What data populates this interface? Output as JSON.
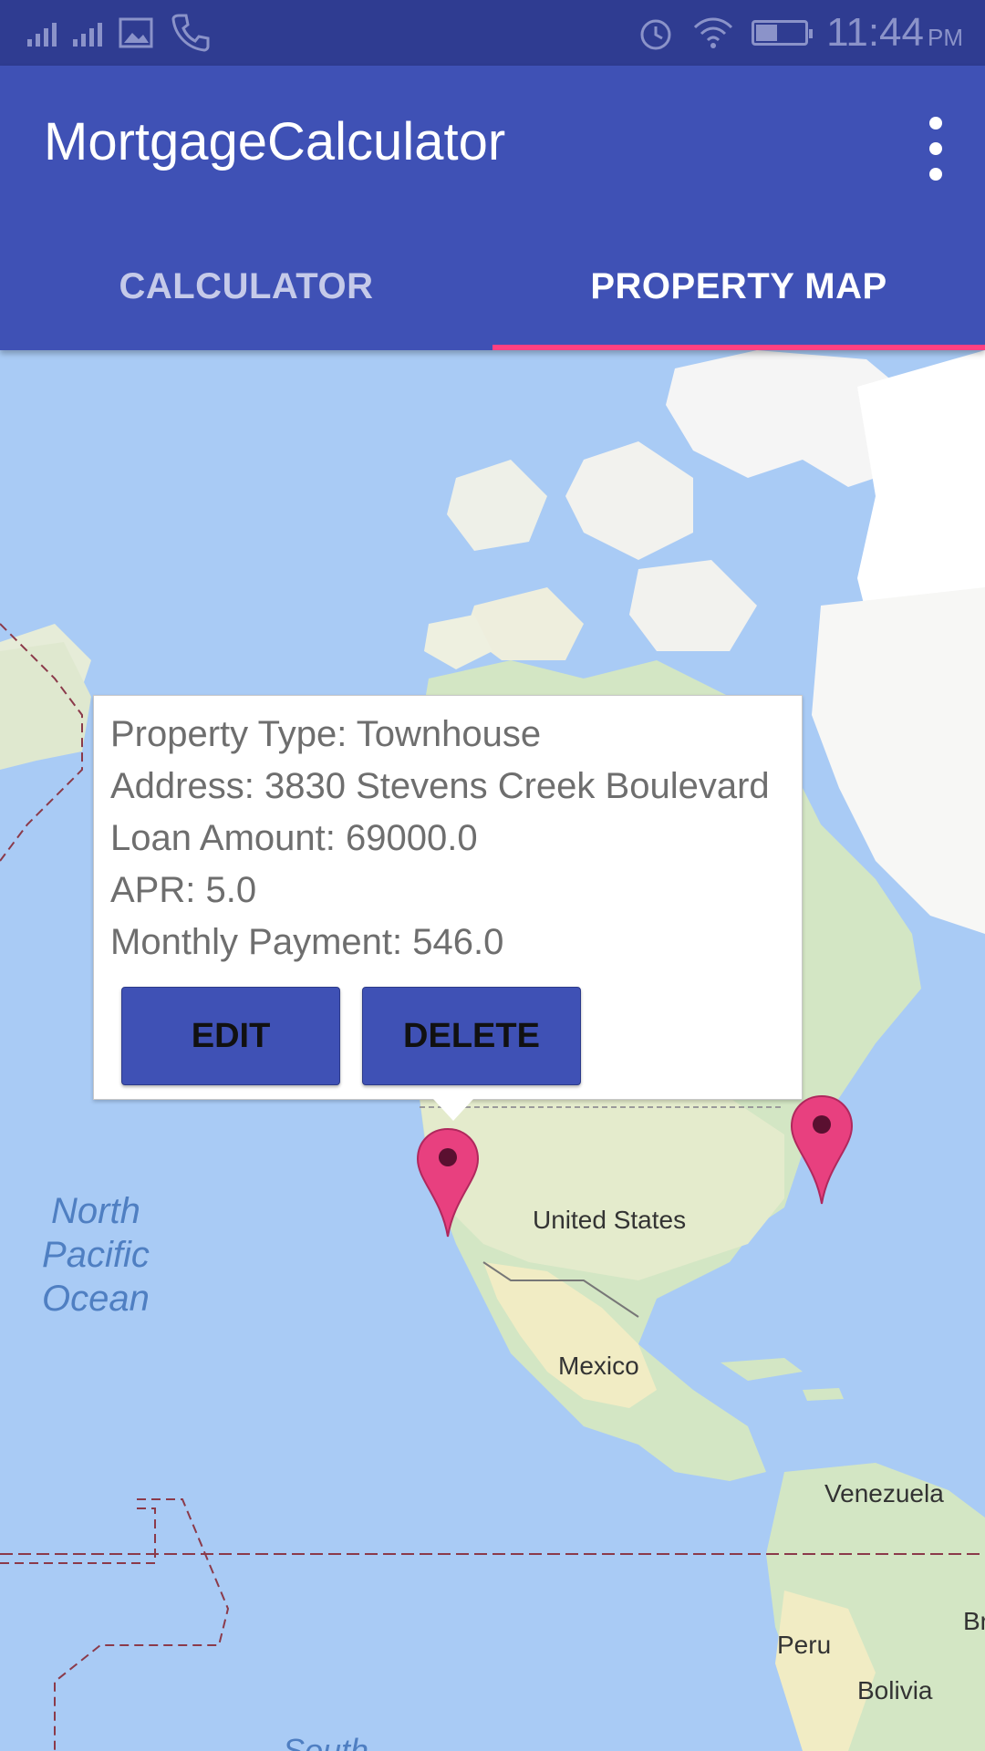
{
  "status_bar": {
    "time": "11:44",
    "ampm": "PM"
  },
  "app_bar": {
    "title": "MortgageCalculator"
  },
  "tabs": [
    {
      "label": "CALCULATOR",
      "active": false
    },
    {
      "label": "PROPERTY MAP",
      "active": true
    }
  ],
  "colors": {
    "primary": "#3f51b5",
    "primary_dark": "#2f3c91",
    "accent": "#ff4081",
    "marker": "#e8407f"
  },
  "map": {
    "labels": {
      "ocean_line1": "North",
      "ocean_line2": "Pacific",
      "ocean_line3": "Ocean",
      "united_states": "United States",
      "mexico": "Mexico",
      "venezuela": "Venezuela",
      "peru": "Peru",
      "bolivia": "Bolivia",
      "brazil": "Brazi",
      "south": "South"
    },
    "markers": [
      "pin-icon",
      "pin-icon"
    ]
  },
  "info_window": {
    "property_type": "Property Type: Townhouse",
    "address": "Address: 3830 Stevens Creek Boulevard",
    "loan_amount": "Loan Amount: 69000.0",
    "apr": "APR: 5.0",
    "monthly_payment": "Monthly Payment: 546.0",
    "edit_label": "EDIT",
    "delete_label": "DELETE"
  }
}
